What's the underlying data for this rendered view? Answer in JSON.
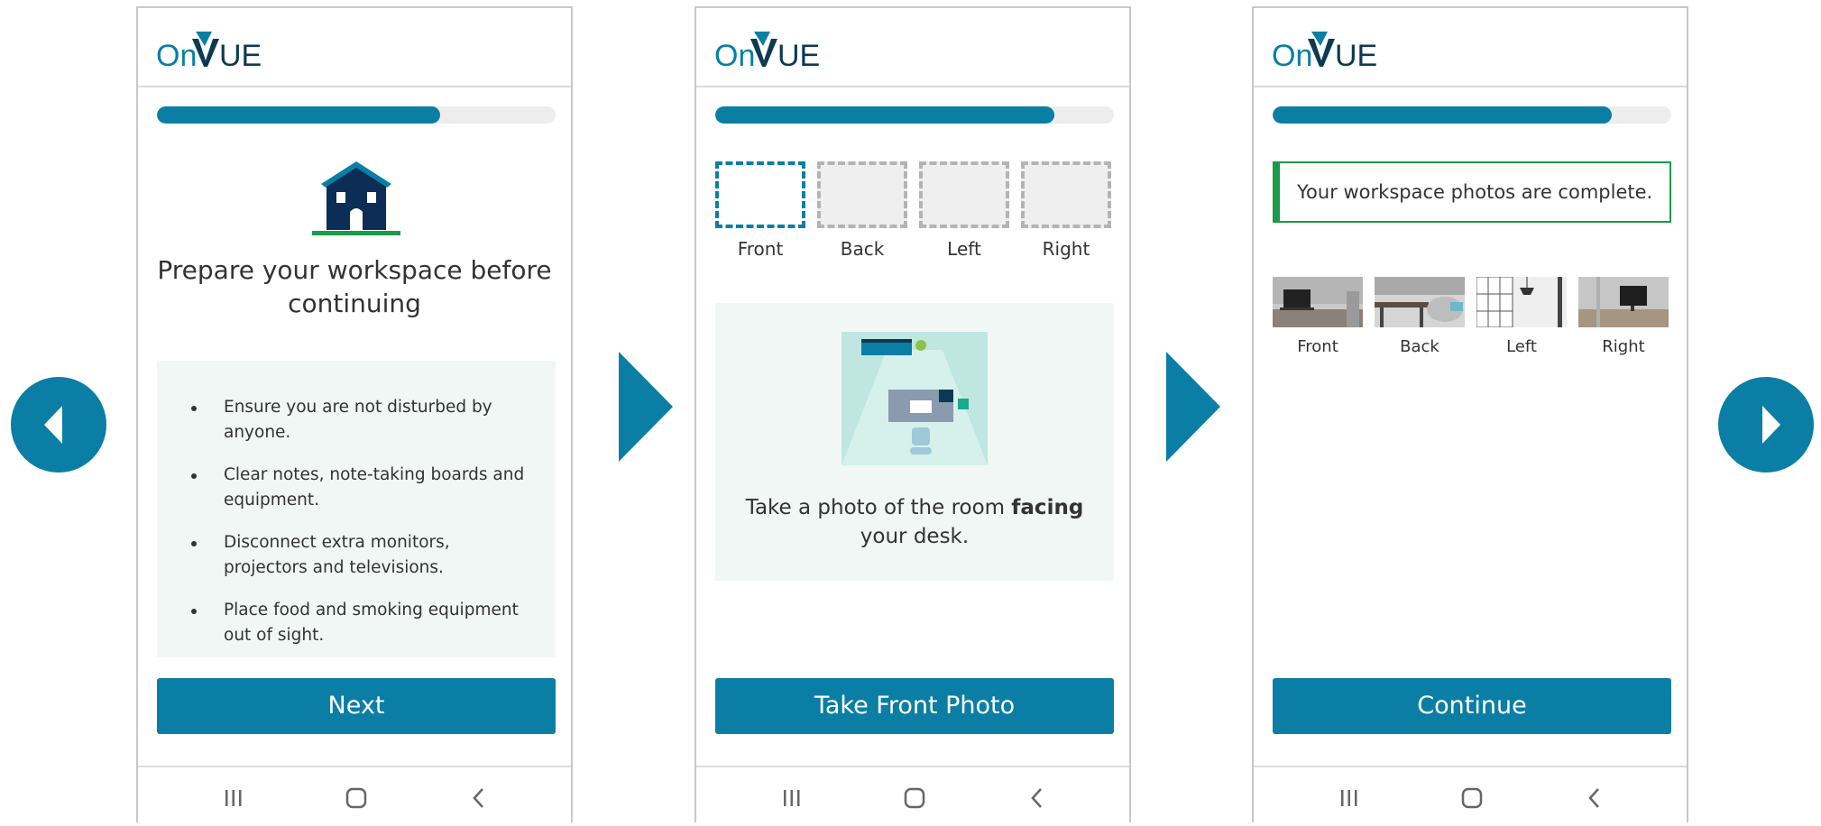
{
  "brand": {
    "logo_text": "OnVUE",
    "accent": "#0a7ea4",
    "success": "#1a9a4a"
  },
  "outer_nav": {
    "prev_icon": "triangle-left-icon",
    "next_icon": "triangle-right-icon"
  },
  "screen1": {
    "progress": 0.71,
    "icon": "house-icon",
    "title": "Prepare your workspace before continuing",
    "tips": [
      "Ensure you are not disturbed by anyone.",
      "Clear notes, note-taking boards and equipment.",
      "Disconnect extra monitors, projectors and televisions.",
      "Place food and smoking equipment out of sight."
    ],
    "button": "Next"
  },
  "screen2": {
    "progress": 0.85,
    "slots": [
      "Front",
      "Back",
      "Left",
      "Right"
    ],
    "active_slot": "Front",
    "instruction_pre": "Take a photo of the room ",
    "instruction_bold": "facing",
    "instruction_post": " your desk.",
    "button": "Take Front Photo"
  },
  "screen3": {
    "progress": 0.85,
    "success_message": "Your workspace photos are complete.",
    "photos": [
      "Front",
      "Back",
      "Left",
      "Right"
    ],
    "button": "Continue"
  },
  "android_nav": {
    "recent_icon": "recent-apps-icon",
    "home_icon": "home-icon",
    "back_icon": "back-icon"
  }
}
